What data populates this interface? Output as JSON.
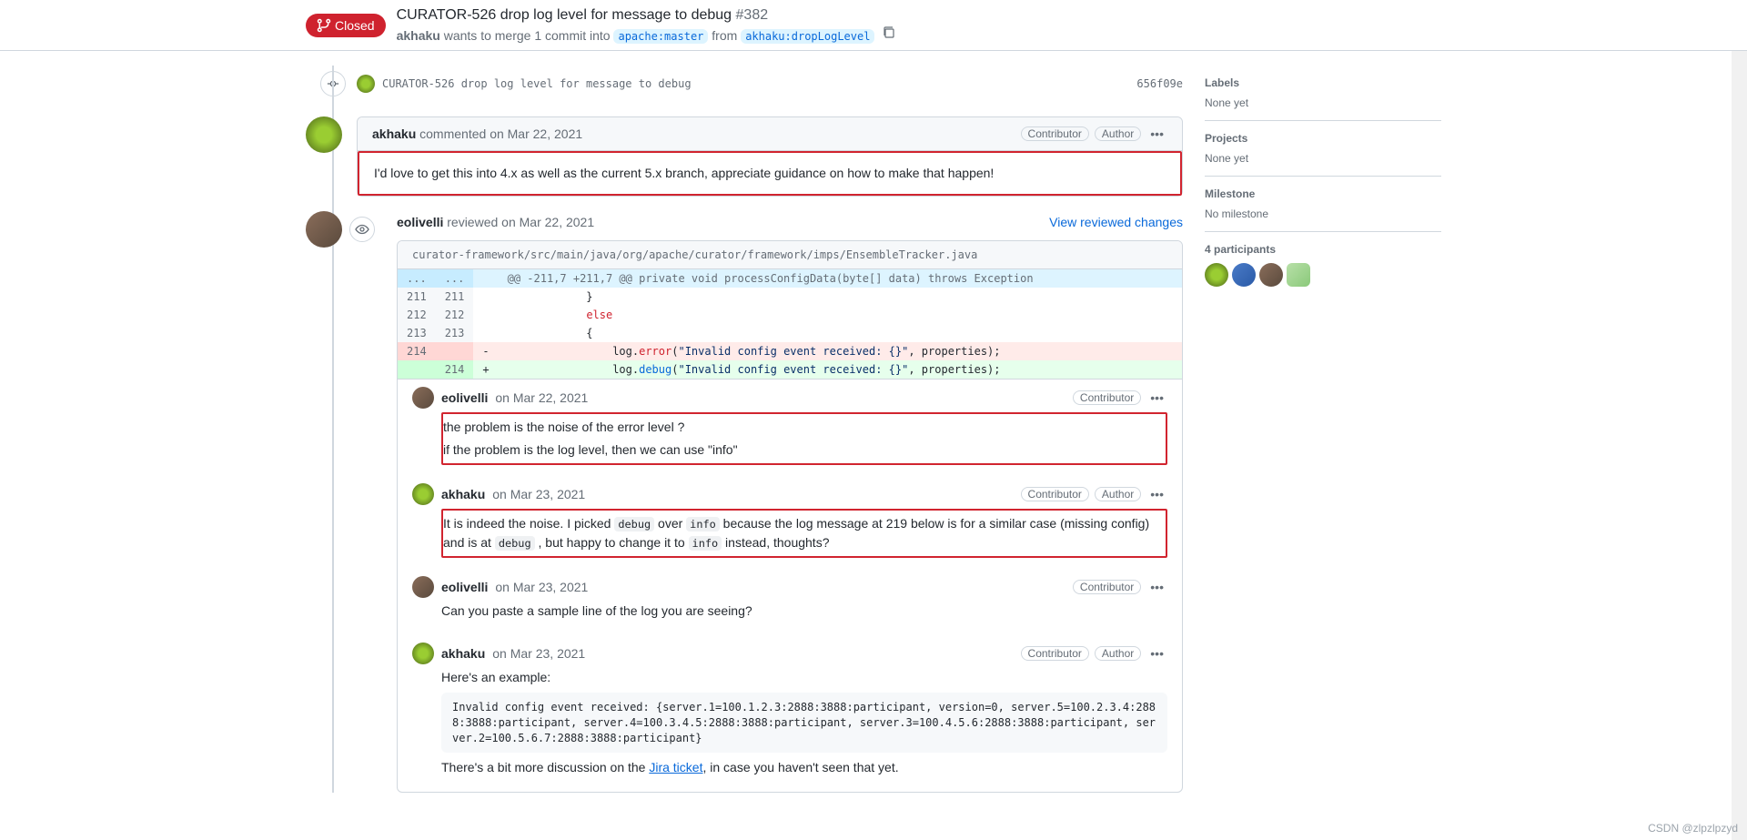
{
  "header": {
    "state": "Closed",
    "title": "CURATOR-526 drop log level for message to debug",
    "issue_number": "#382",
    "meta": {
      "author": "akhaku",
      "verb": " wants to merge 1 commit into ",
      "base_branch": "apache:master",
      "from_word": " from ",
      "head_branch": "akhaku:dropLogLevel"
    }
  },
  "commit_line": {
    "msg": "CURATOR-526 drop log level for message to debug",
    "sha": "656f09e"
  },
  "comments": [
    {
      "author": "akhaku",
      "action": "commented ",
      "date": "on Mar 22, 2021",
      "labels": [
        "Contributor",
        "Author"
      ],
      "body": "I'd love to get this into 4.x as well as the current 5.x branch, appreciate guidance on how to make that happen!"
    }
  ],
  "review": {
    "author": "eolivelli",
    "action": "reviewed ",
    "date": "on Mar 22, 2021",
    "view_changes": "View reviewed changes",
    "file_path": "curator-framework/src/main/java/org/apache/curator/framework/imps/EnsembleTracker.java",
    "hunk": "@@ -211,7 +211,7 @@ private void processConfigData(byte[] data) throws Exception",
    "diff_lines": {
      "l211": "211",
      "r211": "211",
      "c211": "            }",
      "l212": "212",
      "r212": "212",
      "c212_a": "            ",
      "c212_k": "else",
      "l213": "213",
      "r213": "213",
      "c213": "            {",
      "l214": "214",
      "r214": "214",
      "del_pre": "                log.",
      "del_call": "error",
      "del_post": "(",
      "del_str": "\"Invalid config event received: {}\"",
      "del_tail": ", properties);",
      "add_pre": "                log.",
      "add_call": "debug",
      "add_post": "(",
      "add_str": "\"Invalid config event received: {}\"",
      "add_tail": ", properties);"
    },
    "replies": [
      {
        "author": "eolivelli",
        "date": "on Mar 22, 2021",
        "labels": [
          "Contributor"
        ],
        "body_p1": "the problem is the noise of the error level ?",
        "body_p2": "if the problem is the log level, then we can use \"info\""
      },
      {
        "author": "akhaku",
        "date": "on Mar 23, 2021",
        "labels": [
          "Contributor",
          "Author"
        ],
        "body_pre": "It is indeed the noise. I picked ",
        "code1": "debug",
        "body_mid1": " over ",
        "code2": "info",
        "body_mid2": " because the log message at 219 below is for a similar case (missing config) and is at ",
        "code3": "debug",
        "body_mid3": " , but happy to change it to ",
        "code4": "info",
        "body_end": " instead, thoughts?"
      },
      {
        "author": "eolivelli",
        "date": "on Mar 23, 2021",
        "labels": [
          "Contributor"
        ],
        "body_p1": "Can you paste a sample line of the log you are seeing?"
      },
      {
        "author": "akhaku",
        "date": "on Mar 23, 2021",
        "labels": [
          "Contributor",
          "Author"
        ],
        "body_p1": "Here's an example:",
        "code_block": "Invalid config event received: {server.1=100.1.2.3:2888:3888:participant, version=0, server.5=100.2.3.4:2888:3888:participant, server.4=100.3.4.5:2888:3888:participant, server.3=100.4.5.6:2888:3888:participant, server.2=100.5.6.7:2888:3888:participant}",
        "body_p2_pre": "There's a bit more discussion on the ",
        "link_text": "Jira ticket",
        "body_p2_post": ", in case you haven't seen that yet."
      }
    ]
  },
  "sidebar": {
    "labels_heading": "Labels",
    "labels_value": "None yet",
    "projects_heading": "Projects",
    "projects_value": "None yet",
    "milestone_heading": "Milestone",
    "milestone_value": "No milestone",
    "participants_heading": "4 participants"
  },
  "watermark": "CSDN @zlpzlpzyd"
}
